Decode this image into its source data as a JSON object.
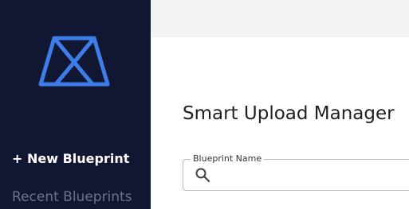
{
  "sidebar": {
    "logo_icon": "blueprint-logo-icon",
    "new_blueprint_label": "+ New Blueprint",
    "recent_label": "Recent Blueprints"
  },
  "main": {
    "title": "Smart Upload Manager",
    "blueprint_field": {
      "label": "Blueprint Name",
      "value": "",
      "icon": "search-icon"
    }
  },
  "colors": {
    "sidebar_bg": "#111633",
    "logo_blue": "#3d7de8",
    "topbar_bg": "#f3f3f3",
    "recent_text": "#6e7289"
  }
}
